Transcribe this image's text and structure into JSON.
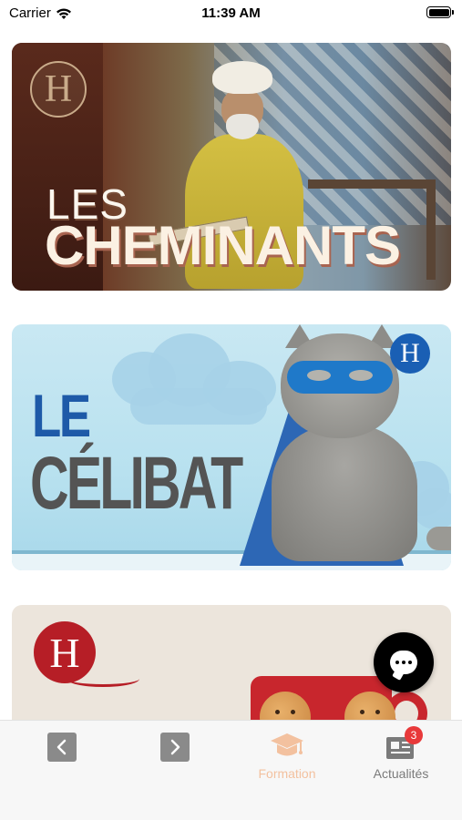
{
  "status_bar": {
    "carrier": "Carrier",
    "time": "11:39 AM"
  },
  "feed": {
    "cards": [
      {
        "title_line1": "LES",
        "title_line2": "CHEMINANTS",
        "logo_letter": "H",
        "accent_color": "#fbf1e3"
      },
      {
        "title_line1": "LE",
        "title_line2": "CÉLIBAT",
        "logo_letter": "H",
        "accent_color": "#1e5aa8"
      },
      {
        "logo_letter": "H",
        "accent_color": "#b61e26"
      }
    ]
  },
  "tab_bar": {
    "tabs": [
      {
        "label": "Formation",
        "icon": "graduation-cap-icon",
        "color": "#f3c19f"
      },
      {
        "label": "Actualités",
        "icon": "news-icon",
        "badge": "3",
        "color": "#7a7a7a"
      }
    ],
    "nav": {
      "back_icon": "chevron-left-icon",
      "forward_icon": "chevron-right-icon"
    }
  },
  "chat": {
    "icon": "chat-bubble-icon"
  }
}
